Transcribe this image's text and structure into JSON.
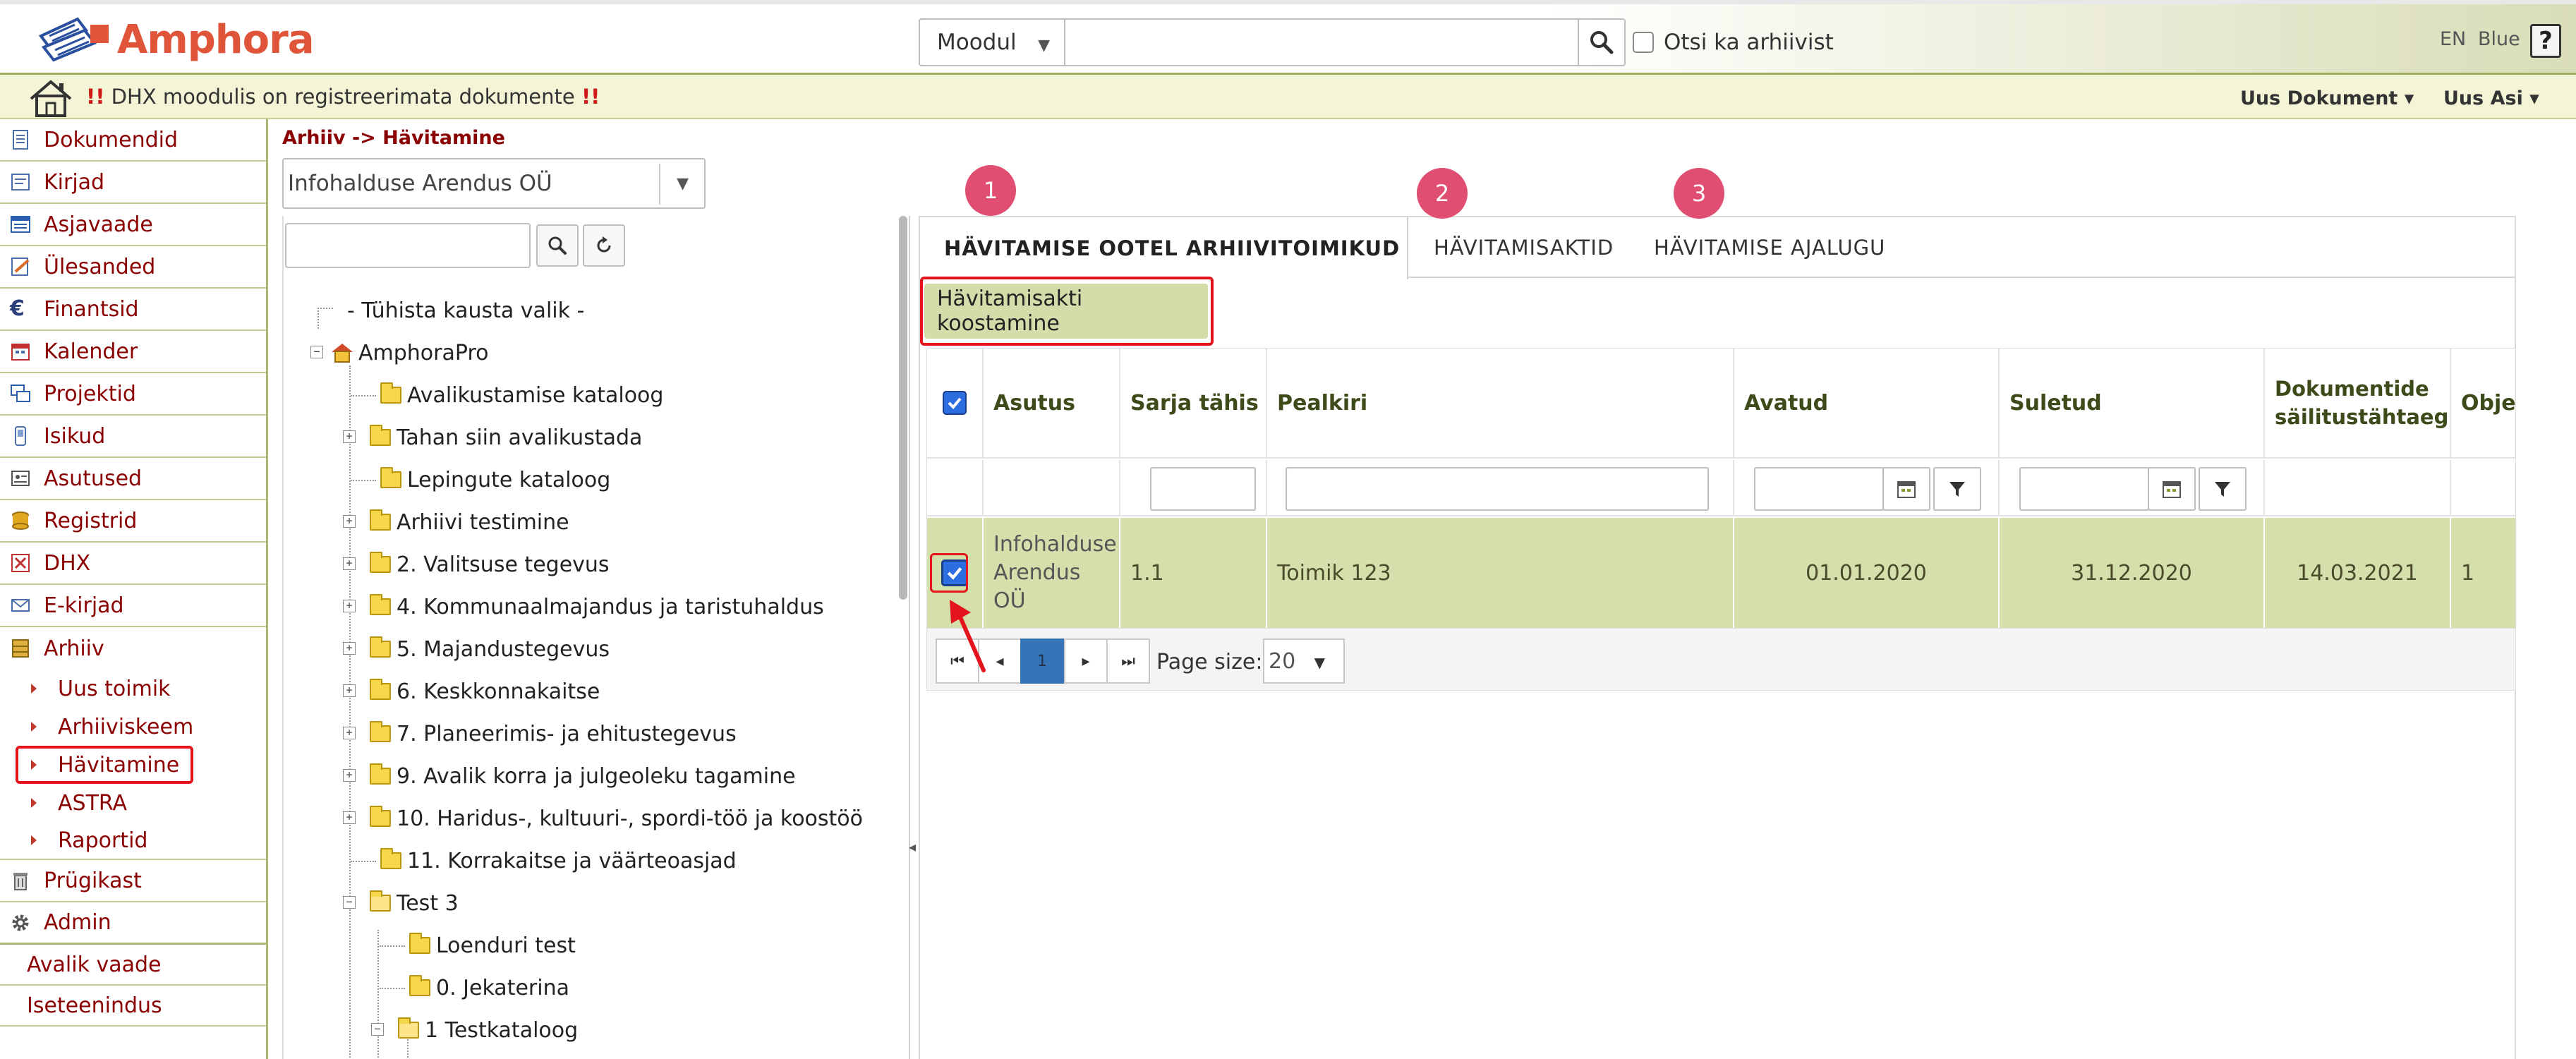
{
  "header": {
    "brand": "Amphora",
    "module_select": "Moodul",
    "search_value": "",
    "archive_search_label": "Otsi ka arhiivist",
    "lang": "EN",
    "theme": "Blue",
    "help": "?"
  },
  "notification": {
    "bang_left": "!!",
    "text": " DHX moodulis on registreerimata dokumente ",
    "bang_right": "!!",
    "menu_new_doc": "Uus Dokument ▾",
    "menu_new_case": "Uus Asi ▾"
  },
  "sidebar": {
    "items": [
      {
        "label": "Dokumendid",
        "icon": "document-icon"
      },
      {
        "label": "Kirjad",
        "icon": "letter-icon"
      },
      {
        "label": "Asjavaade",
        "icon": "case-view-icon"
      },
      {
        "label": "Ülesanded",
        "icon": "tasks-icon"
      },
      {
        "label": "Finantsid",
        "icon": "euro-icon"
      },
      {
        "label": "Kalender",
        "icon": "calendar-icon"
      },
      {
        "label": "Projektid",
        "icon": "projects-icon"
      },
      {
        "label": "Isikud",
        "icon": "person-icon"
      },
      {
        "label": "Asutused",
        "icon": "institution-icon"
      },
      {
        "label": "Registrid",
        "icon": "registry-icon"
      },
      {
        "label": "DHX",
        "icon": "dhx-icon"
      },
      {
        "label": "E-kirjad",
        "icon": "email-icon"
      },
      {
        "label": "Arhiiv",
        "icon": "archive-icon"
      }
    ],
    "archive_sub": [
      "Uus toimik",
      "Arhiiviskeem",
      "Hävitamine",
      "ASTRA",
      "Raportid"
    ],
    "bottom_items": [
      {
        "label": "Prügikast",
        "icon": "trash-icon"
      },
      {
        "label": "Admin",
        "icon": "gear-icon"
      }
    ],
    "links": [
      "Avalik vaade",
      "Iseteenindus"
    ]
  },
  "breadcrumb": "Arhiiv -> Hävitamine",
  "org_select": "Infohalduse Arendus OÜ",
  "tree": {
    "search_value": "",
    "clear_label": "- Tühista kausta valik -",
    "root": "AmphoraPro",
    "nodes": [
      "Avalikustamise kataloog",
      "Tahan siin avalikustada",
      "Lepingute kataloog",
      "Arhiivi testimine",
      "2. Valitsuse tegevus",
      "4. Kommunaalmajandus ja taristuhaldus",
      "5. Majandustegevus",
      "6. Keskkonnakaitse",
      "7. Planeerimis- ja ehitustegevus",
      "9. Avalik korra ja julgeoleku tagamine",
      "10. Haridus-, kultuuri-, spordi-töö ja koostöö",
      "11. Korrakaitse ja väärteoasjad",
      "Test 3",
      "Loenduri test",
      "0. Jekaterina",
      "1 Testkataloog"
    ]
  },
  "tabs": [
    {
      "label": "HÄVITAMISE OOTEL ARHIIVITOIMIKUD",
      "badge": "1"
    },
    {
      "label": "HÄVITAMISAKTID",
      "badge": "2"
    },
    {
      "label": "HÄVITAMISE AJALUGU",
      "badge": "3"
    }
  ],
  "compose_button": "Hävitamisakti koostamine",
  "grid": {
    "columns": [
      "Asutus",
      "Sarja tähis",
      "Pealkiri",
      "Avatud",
      "Suletud",
      "Dokumentide säilitustähtaeg",
      "Objel"
    ],
    "rows": [
      {
        "asutus": "Infohalduse Arendus OÜ",
        "sarja": "1.1",
        "pealkiri": "Toimik 123",
        "avatud": "01.01.2020",
        "suletud": "31.12.2020",
        "tahtaeg": "14.03.2021",
        "obj": "1"
      }
    ]
  },
  "pager": {
    "current_page": "1",
    "page_size_label": "Page size:",
    "page_size": "20"
  },
  "colors": {
    "accent_red": "#e3141c",
    "badge_pink": "#e04f72",
    "row_selected": "#d5dfac",
    "brand_orange": "#e0553a"
  }
}
